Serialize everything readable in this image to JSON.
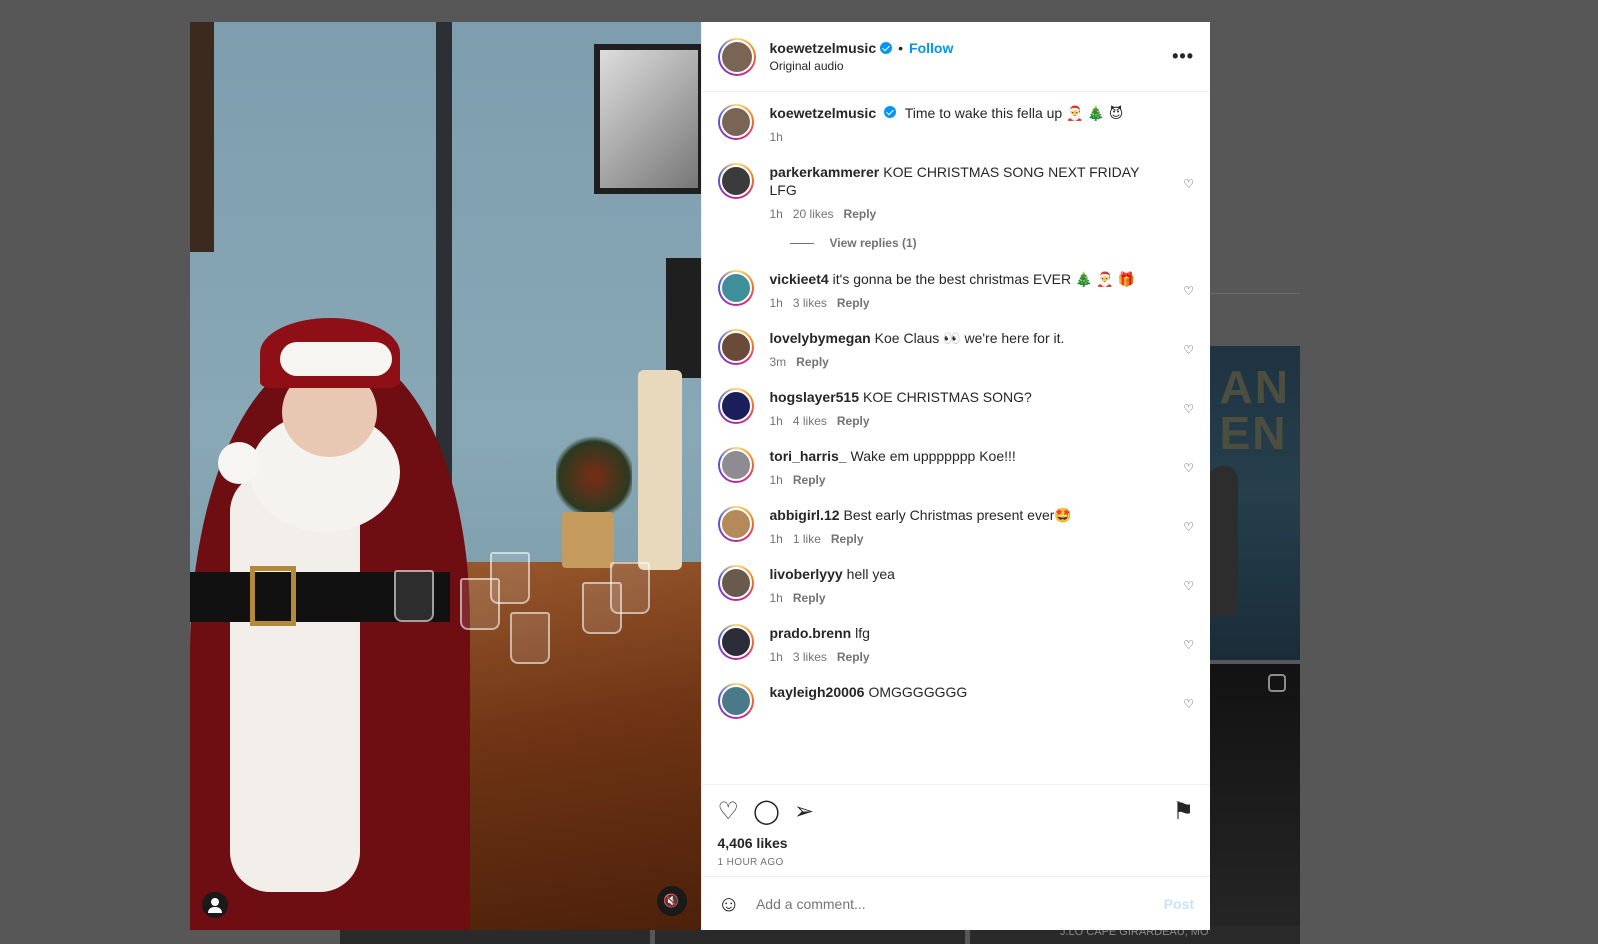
{
  "colors": {
    "accent": "#0095f6",
    "text": "#262626",
    "muted": "#737373",
    "backdrop": "#575757"
  },
  "background": {
    "card_text": "AN\nEN",
    "bottom_caption": "J.LO CAPE GIRARDEAU, MO"
  },
  "post": {
    "author": "koewetzelmusic",
    "follow_label": "Follow",
    "audio": "Original audio",
    "more_icon": "more-horizontal-icon",
    "caption": {
      "username": "koewetzelmusic",
      "text": "Time to wake this fella up 🎅 🎄 😈",
      "time": "1h"
    }
  },
  "comments": [
    {
      "username": "parkerkammerer",
      "text": "KOE CHRISTMAS SONG NEXT FRIDAY LFG",
      "time": "1h",
      "likes": "20 likes",
      "reply": "Reply",
      "view_replies": "View replies (1)",
      "avatar_color": "#3b3b3b"
    },
    {
      "username": "vickieet4",
      "text": "it's gonna be the best christmas EVER 🎄 🎅 🎁",
      "time": "1h",
      "likes": "3 likes",
      "reply": "Reply",
      "avatar_color": "#3f8f9a"
    },
    {
      "username": "lovelybymegan",
      "text": "Koe Claus 👀 we're here for it.",
      "time": "3m",
      "likes": "",
      "reply": "Reply",
      "avatar_color": "#6b4a3a"
    },
    {
      "username": "hogslayer515",
      "text": "KOE CHRISTMAS SONG?",
      "time": "1h",
      "likes": "4 likes",
      "reply": "Reply",
      "avatar_color": "#1a1f5a"
    },
    {
      "username": "tori_harris_",
      "text": "Wake em uppppppp Koe!!!",
      "time": "1h",
      "likes": "",
      "reply": "Reply",
      "avatar_color": "#8e8c92"
    },
    {
      "username": "abbigirl.12",
      "text": "Best early Christmas present ever🤩",
      "time": "1h",
      "likes": "1 like",
      "reply": "Reply",
      "avatar_color": "#b48a5a"
    },
    {
      "username": "livoberlyyy",
      "text": "hell yea",
      "time": "1h",
      "likes": "",
      "reply": "Reply",
      "avatar_color": "#6a5a4e"
    },
    {
      "username": "prado.brenn",
      "text": "lfg",
      "time": "1h",
      "likes": "3 likes",
      "reply": "Reply",
      "avatar_color": "#2d2d3a"
    },
    {
      "username": "kayleigh20006",
      "text": "OMGGGGGGG",
      "time": "",
      "likes": "",
      "reply": "",
      "avatar_color": "#4a7a8a"
    }
  ],
  "engagement": {
    "likes": "4,406 likes",
    "time_ago": "1 HOUR AGO"
  },
  "add_comment": {
    "placeholder": "Add a comment...",
    "post_label": "Post"
  },
  "icons": {
    "like": "heart-icon",
    "comment": "comment-icon",
    "share": "share-icon",
    "save": "bookmark-icon",
    "emoji": "emoji-icon",
    "mute": "muted-speaker-icon",
    "tag": "user-tag-icon"
  }
}
